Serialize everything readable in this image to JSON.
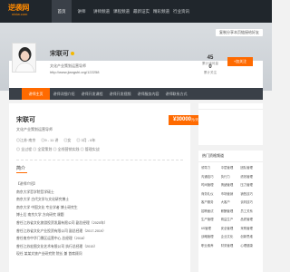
{
  "brand": {
    "logo_main": "逆袭网",
    "logo_sub": "nixiw.com",
    "accent": "#ff6a00",
    "dark": "#20262c"
  },
  "nav": [
    "首页",
    "讲师",
    "讲师频道",
    "课程频道",
    "最新证实",
    "精彩频道",
    "行业资讯"
  ],
  "hero": {
    "share_label": "复制分享本页链接给好友"
  },
  "profile": {
    "name": "宋联可",
    "motto": "文化产业策划运营导师",
    "url": "http://www.jiangshi.org/122258",
    "stats": [
      {
        "num": "45",
        "label": "累计访问量"
      },
      {
        "num": "0",
        "label": "累计关注"
      }
    ],
    "follow_label": "+加关注"
  },
  "tabs": [
    "讲师主页",
    "讲师详细介绍",
    "讲师开发课程",
    "讲师开发视频",
    "讲师服务内容",
    "讲师联系方式"
  ],
  "main": {
    "title": "宋联可",
    "subtitle": "文化产业策划运营导师",
    "meta": [
      "◎江苏·南京",
      "◎9 - 11 讲",
      "◎女",
      "◎ 3月 - 6年"
    ],
    "tags": "◎ 全过程 ◎ 全案策划 ◎ 全线营销实践 ◎ 管理实战",
    "price": "¥30000",
    "price_unit": "元/天",
    "section_title": "简介",
    "intro": [
      "【讲师介绍】",
      "南京大学哲学院哲学硕士",
      "南京大学 古代文学与文化研究博士",
      "南京大学 中国文化 专业学者 博士研究生",
      "博士后 南京大学 方向研究 课题",
      "曾任江苏省文化旅游投资发展有限公司 副总经理（2020年）",
      "曾任江苏省文化产业投资有限公司 副总经理（2017-2019）",
      "曾任南京中华门景区运营中心 总经理（2016）",
      "曾任江苏宏图文化艺术有限公司 执行总经理（2015）",
      "现任 某某文旅产业研究院 院长 兼 首席顾问"
    ]
  },
  "side": {
    "ad_label": "",
    "hot_title": "热门资格频道",
    "hot_items": [
      "领导力",
      "中层管理",
      "团队管理",
      "沟通技巧",
      "执行力",
      "绩效管理",
      "时间管理",
      "情绪管理",
      "压力管理",
      "商务礼仪",
      "市场营销",
      "销售技巧",
      "客户服务",
      "大客户",
      "谈判技巧",
      "招聘面试",
      "薪酬管理",
      "员工关系",
      "生产管理",
      "精益生产",
      "品质管理",
      "6S管理",
      "安全管理",
      "采购管理",
      "战略管理",
      "企业文化",
      "创新思维",
      "职业素养",
      "财务管理",
      "心理健康"
    ]
  }
}
